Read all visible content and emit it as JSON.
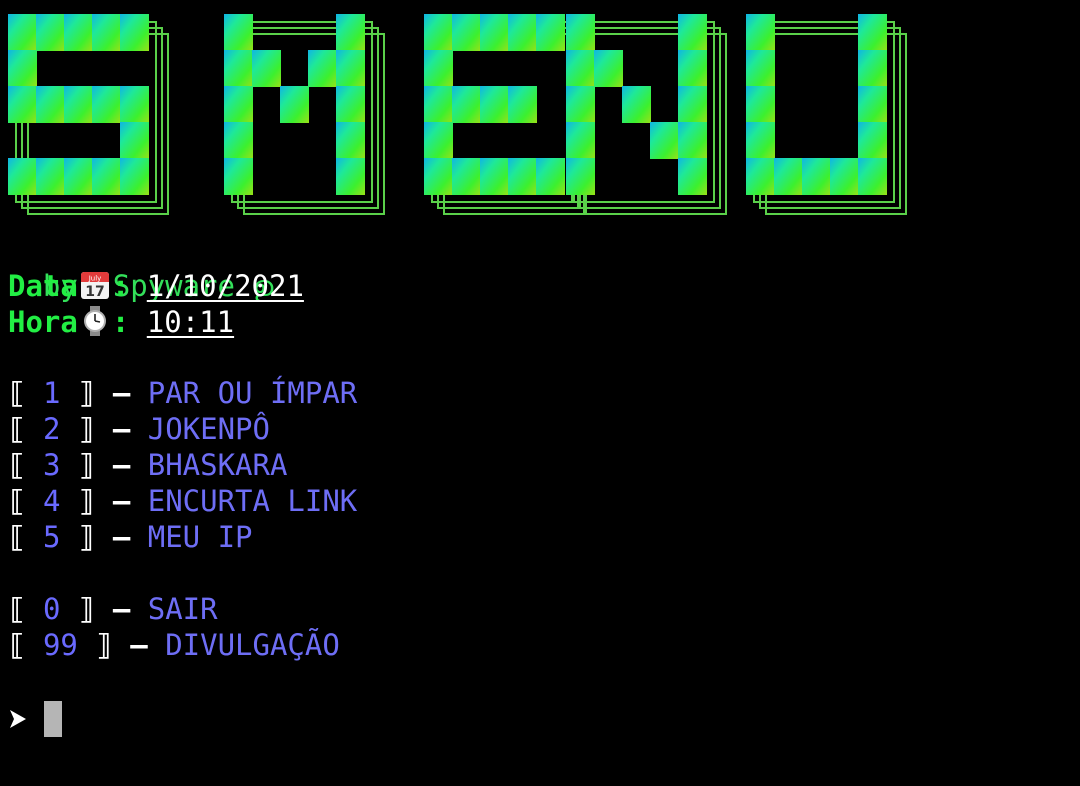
{
  "banner": {
    "text": "S MENU",
    "colors": [
      "#0fb4e6",
      "#1ee89a",
      "#3cf02e",
      "#8ee81e"
    ]
  },
  "header": {
    "by_label": "by: Spyware",
    "by_symbol": "ഉ",
    "date_label": "Data",
    "date_sep": ":",
    "date_value": "1/10/2021",
    "date_icon": "calendar-icon",
    "time_label": "Hora",
    "time_sep": ":",
    "time_value": "10:11",
    "time_icon": "watch-icon",
    "calendar_month": "July",
    "calendar_day": "17"
  },
  "menu": {
    "items": [
      {
        "num": "1",
        "dash": "—",
        "label": "PAR OU ÍMPAR"
      },
      {
        "num": "2",
        "dash": "—",
        "label": "JOKENPÔ"
      },
      {
        "num": "3",
        "dash": "—",
        "label": "BHASKARA"
      },
      {
        "num": "4",
        "dash": "—",
        "label": "ENCURTA LINK"
      },
      {
        "num": "5",
        "dash": "—",
        "label": "MEU IP"
      }
    ],
    "exit_items": [
      {
        "num": "0",
        "dash": "—",
        "label": "SAIR"
      },
      {
        "num": "99",
        "dash": "—",
        "label": "DIVULGAÇÃO"
      }
    ],
    "bracket_open": "⟦",
    "bracket_close": "⟧"
  },
  "prompt": {
    "symbol": "➤"
  }
}
